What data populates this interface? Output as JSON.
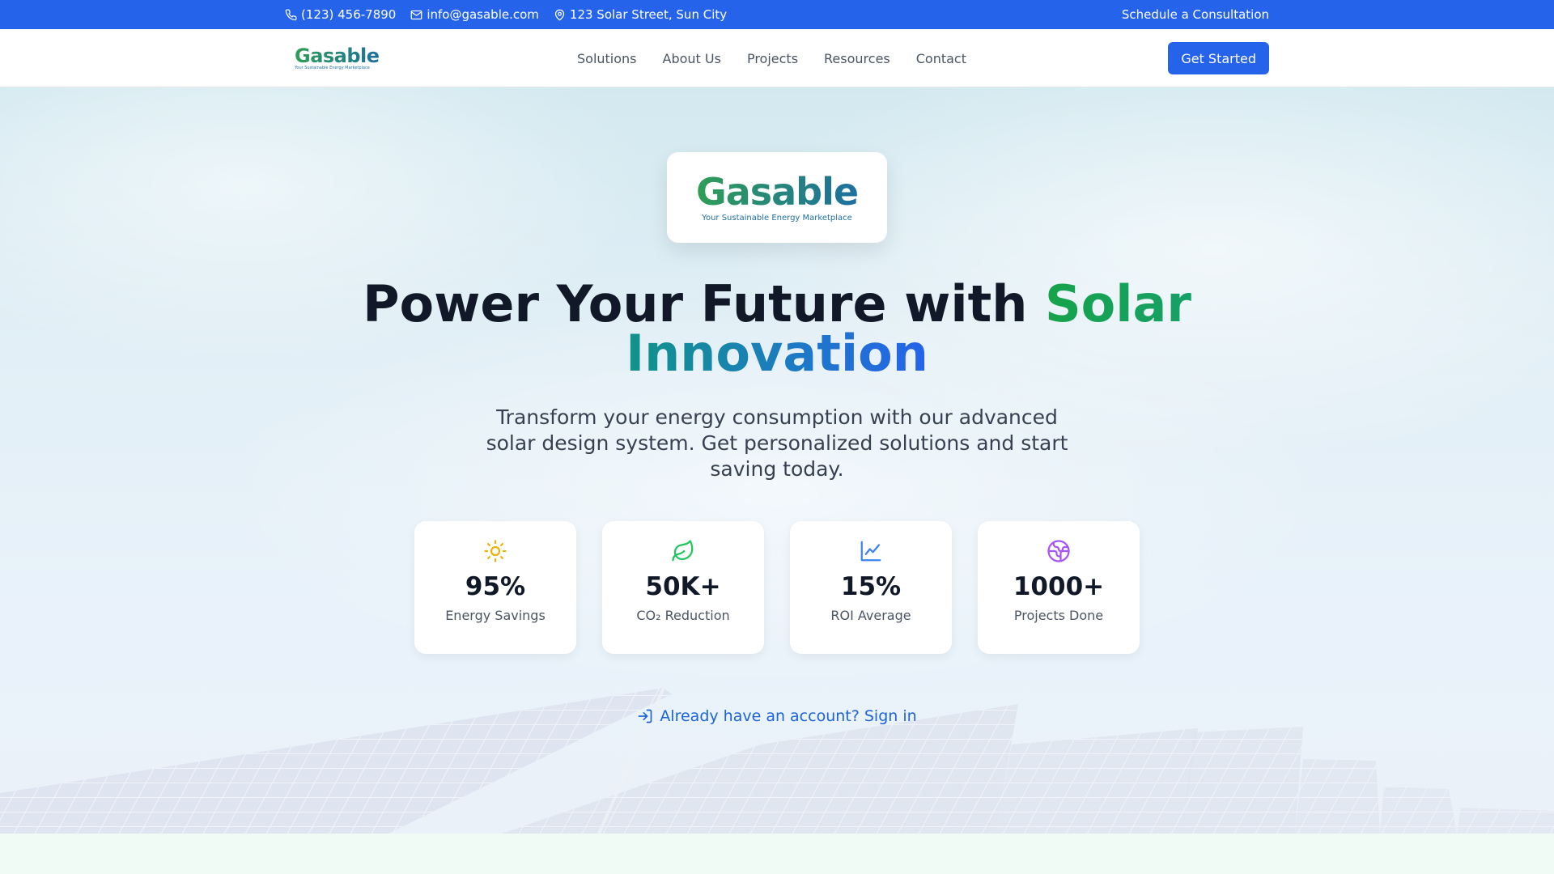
{
  "topbar": {
    "phone": "(123) 456-7890",
    "email": "info@gasable.com",
    "address": "123 Solar Street, Sun City",
    "schedule": "Schedule a Consultation",
    "icons": {
      "phone": "phone-icon",
      "email": "mail-icon",
      "address": "map-pin-icon"
    }
  },
  "nav": {
    "logo": {
      "name": "Gasable",
      "tagline": "Your Sustainable Energy Marketplace"
    },
    "links": [
      "Solutions",
      "About Us",
      "Projects",
      "Resources",
      "Contact"
    ],
    "cta": "Get Started"
  },
  "hero": {
    "logo": {
      "name": "Gasable",
      "tagline": "Your Sustainable Energy Marketplace"
    },
    "headline_main": "Power Your Future with",
    "headline_accent_1": "Solar",
    "headline_accent_2": "Innovation",
    "subheadline": "Transform your energy consumption with our advanced solar design system. Get personalized solutions and start saving today.",
    "stats": [
      {
        "value": "95%",
        "label": "Energy Savings",
        "icon": "sun-icon",
        "color": "#eab308"
      },
      {
        "value": "50K+",
        "label": "CO₂ Reduction",
        "icon": "leaf-icon",
        "color": "#22c55e"
      },
      {
        "value": "15%",
        "label": "ROI Average",
        "icon": "line-chart-icon",
        "color": "#3b82f6"
      },
      {
        "value": "1000+",
        "label": "Projects Done",
        "icon": "globe-icon",
        "color": "#a855f7"
      }
    ],
    "signin": "Already have an account? Sign in",
    "signin_icon": "log-in-icon"
  },
  "colors": {
    "primary": "#2563eb",
    "brand_green": "#16a34a",
    "brand_teal": "#0f9488",
    "text_dark": "#111827",
    "text_muted": "#4b5563"
  }
}
